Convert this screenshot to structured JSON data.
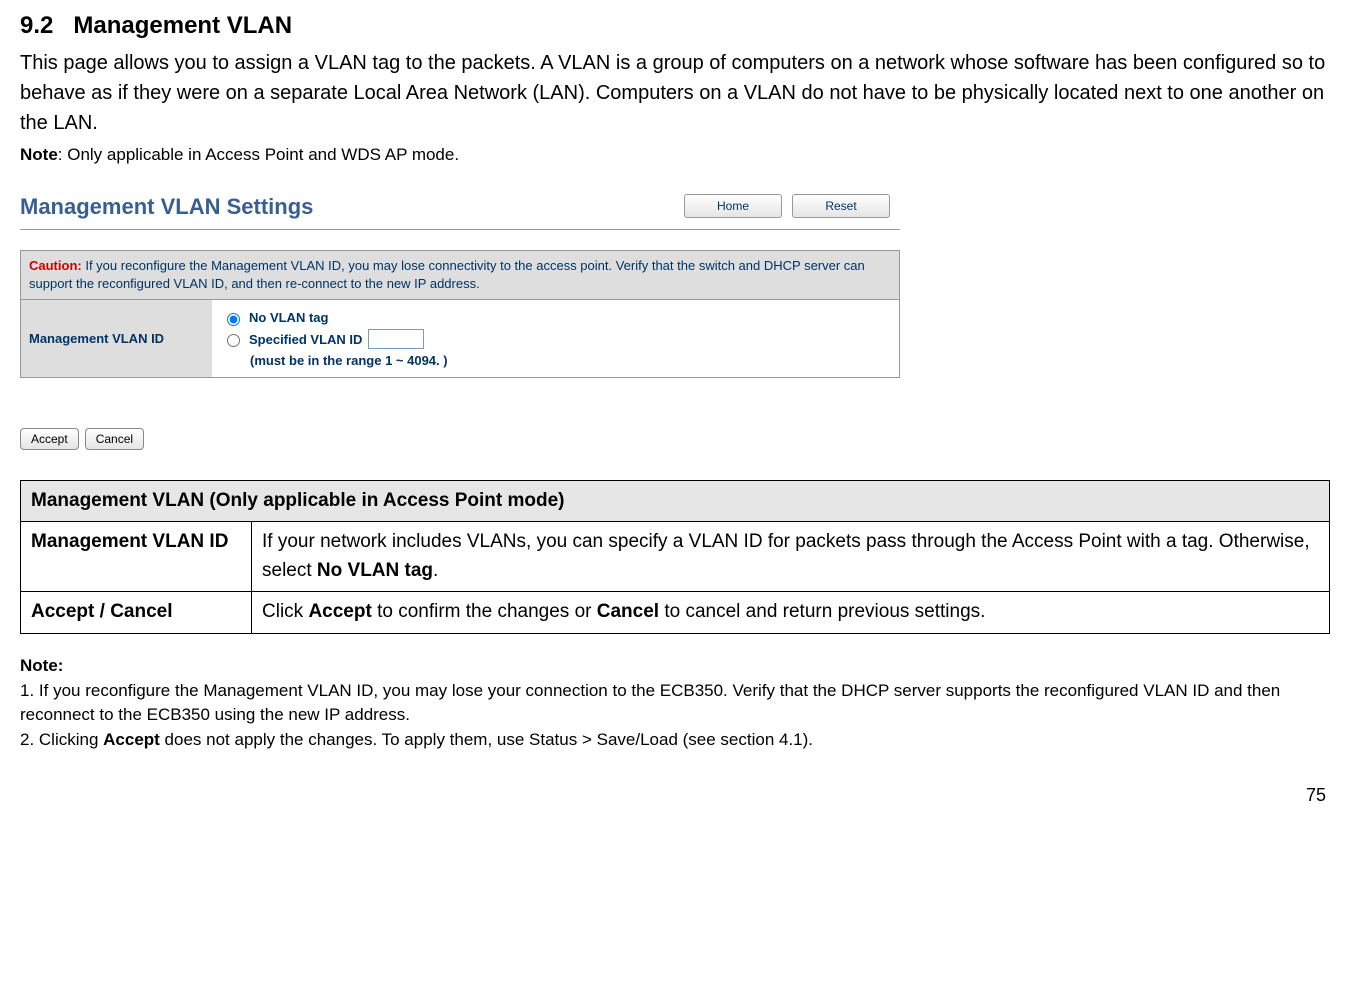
{
  "section": {
    "number": "9.2",
    "title": "Management VLAN"
  },
  "intro": "This page allows you to assign a VLAN tag to the packets. A VLAN is a group of computers on a network whose software has been configured so to behave as if they were on a separate Local Area Network (LAN). Computers on a VLAN do not have to be physically located next to one another on the LAN.",
  "note_line_prefix": "Note",
  "note_line_text": ": Only applicable in Access Point and WDS AP mode.",
  "screenshot": {
    "title": "Management VLAN Settings",
    "home_btn": "Home",
    "reset_btn": "Reset",
    "caution_label": "Caution:",
    "caution_text": " If you reconfigure the Management VLAN ID, you may lose connectivity to the access point. Verify that the switch and DHCP server can support the reconfigured VLAN ID, and then re-connect to the new IP address.",
    "row_label": "Management VLAN ID",
    "opt_no_tag": "No VLAN tag",
    "opt_specified": "Specified VLAN ID",
    "vlan_value": "",
    "range_note": "(must be in the range 1 ~ 4094. )",
    "accept_btn": "Accept",
    "cancel_btn": "Cancel"
  },
  "table": {
    "header": "Management VLAN (Only applicable in Access Point mode)",
    "rows": [
      {
        "label": "Management VLAN ID",
        "text_pre": "If your network includes VLANs, you can specify a VLAN ID for packets pass through the Access Point with a tag. Otherwise, select ",
        "bold1": "No VLAN tag",
        "text_post": "."
      },
      {
        "label": "Accept / Cancel",
        "text_pre": "Click ",
        "bold1": "Accept",
        "mid": " to confirm the changes or ",
        "bold2": "Cancel",
        "text_post": " to cancel and return previous settings."
      }
    ]
  },
  "footer": {
    "heading": "Note:",
    "line1": "1. If you reconfigure the Management VLAN ID, you may lose your connection to the ECB350. Verify that the DHCP server supports the reconfigured VLAN ID and then reconnect to the ECB350 using the new IP address.",
    "line2_pre": "2. Clicking ",
    "line2_bold": "Accept",
    "line2_post": " does not apply the changes. To apply them, use Status > Save/Load (see section 4.1)."
  },
  "page_number": "75"
}
